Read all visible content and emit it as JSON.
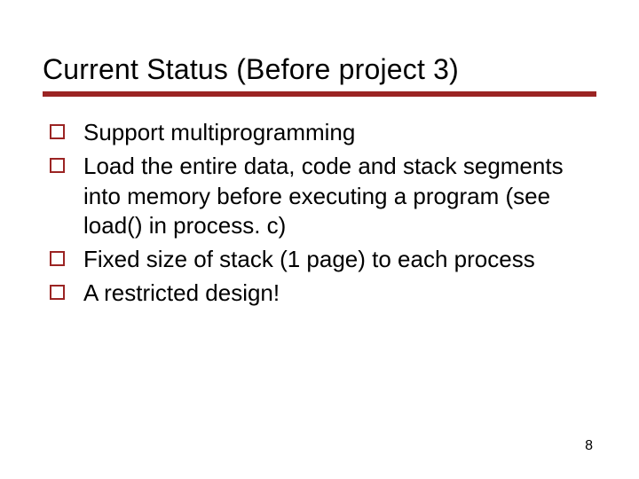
{
  "title": "Current Status (Before project 3)",
  "bullets": [
    {
      "text": "Support multiprogramming"
    },
    {
      "text": "Load the entire data, code and stack segments into memory before executing a program (see load() in process. c)"
    },
    {
      "text": "Fixed size of stack (1 page) to each process"
    },
    {
      "text": "A restricted design!"
    }
  ],
  "page_number": "8",
  "accent_color": "#9b2423"
}
